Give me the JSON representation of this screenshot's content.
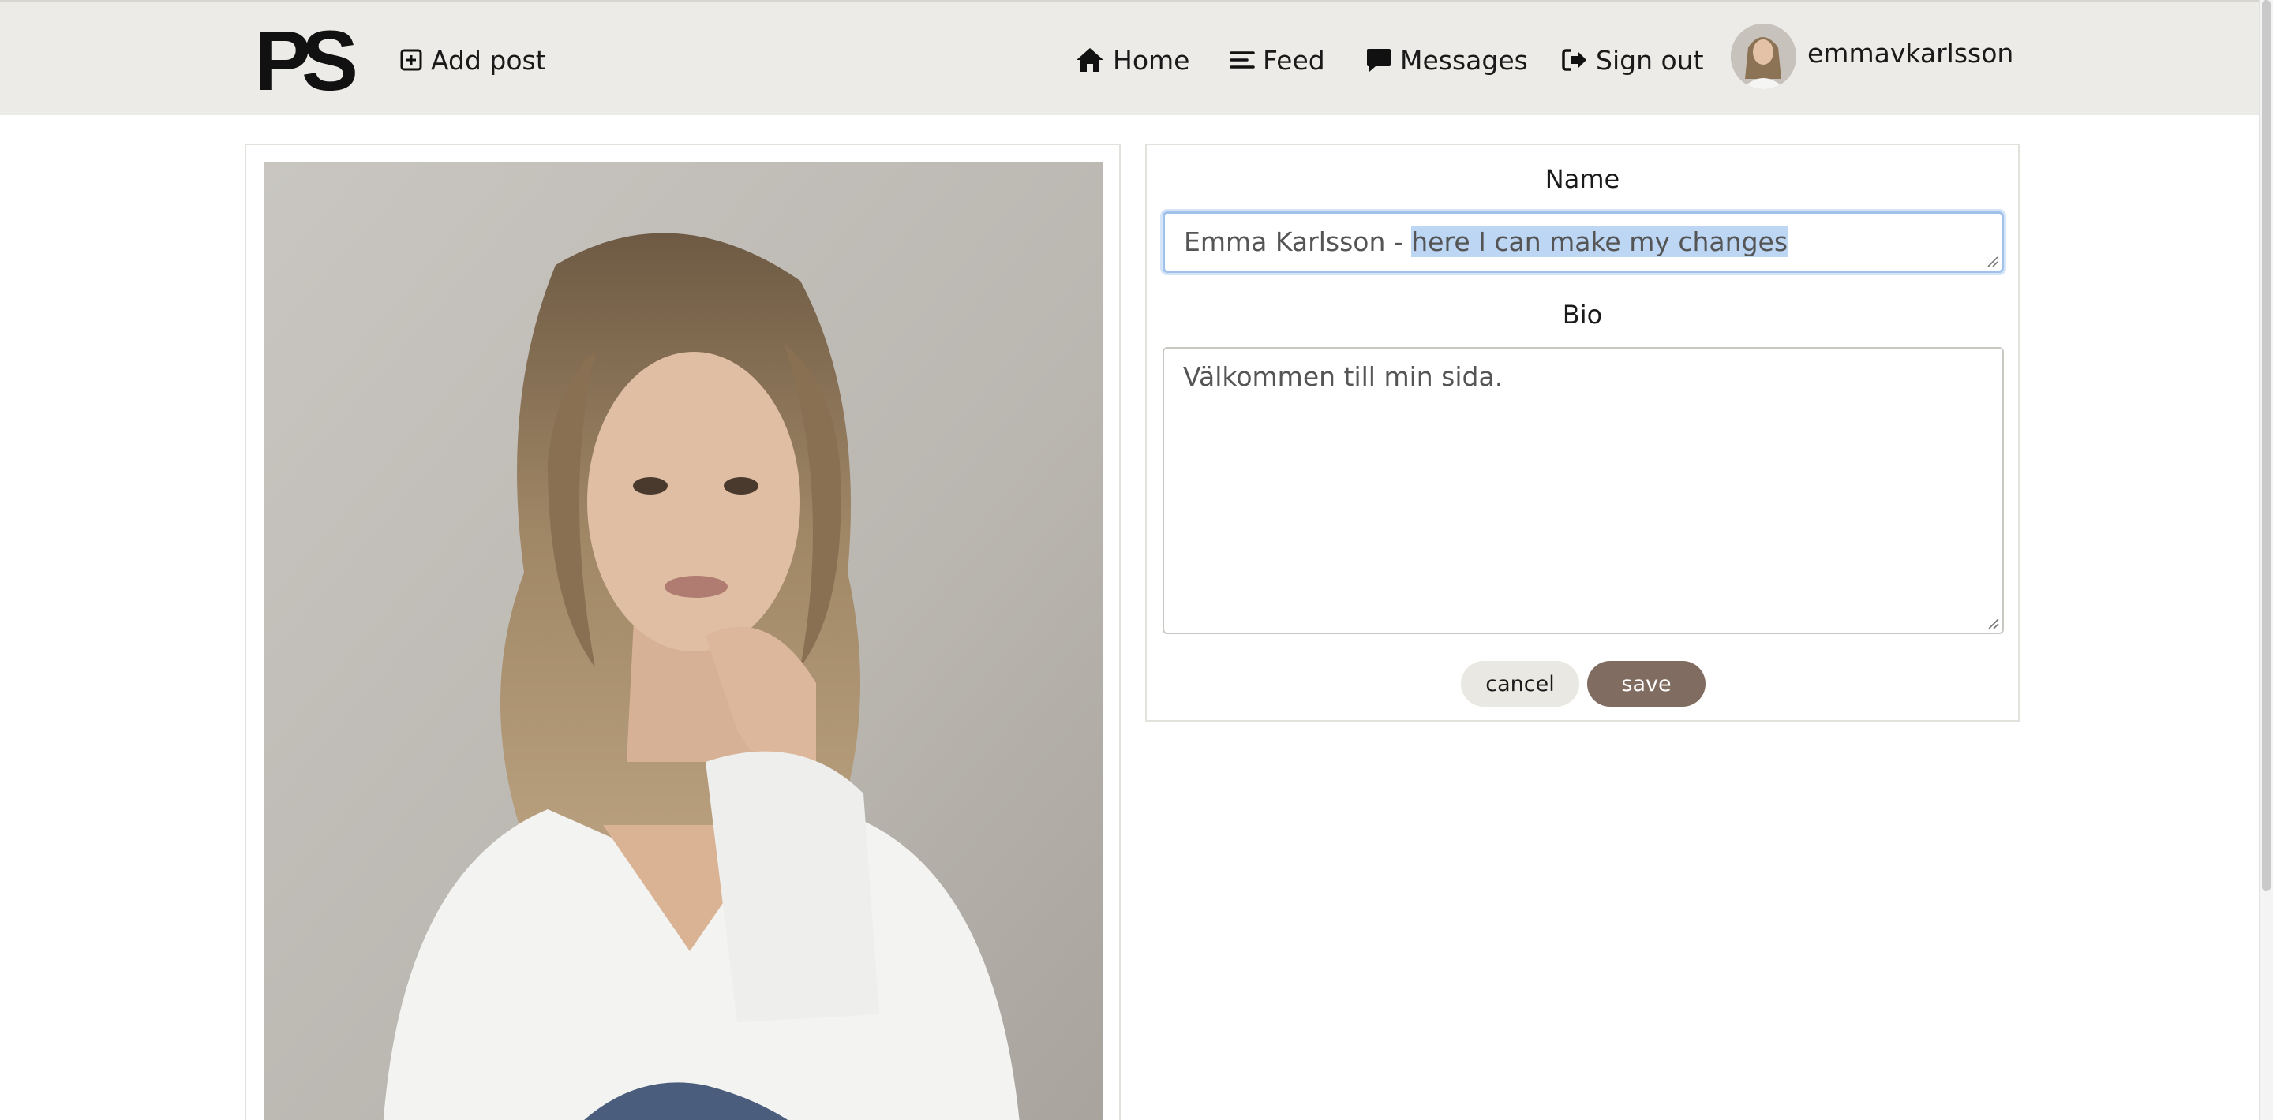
{
  "header": {
    "logo_text": "PS",
    "nav": {
      "add_post": "Add post",
      "home": "Home",
      "feed": "Feed",
      "messages": "Messages",
      "sign_out": "Sign out"
    },
    "username": "emmavkarlsson"
  },
  "edit_profile": {
    "name_label": "Name",
    "name_value_prefix": "Emma Karlsson - ",
    "name_value_selected": "here I can make my changes",
    "bio_label": "Bio",
    "bio_value": "Välkommen till min sida.",
    "cancel_label": "cancel",
    "save_label": "save"
  },
  "colors": {
    "header_bg": "#ecebe7",
    "save_button": "#806c60",
    "cancel_button": "#e9e8e3",
    "focus_ring": "#9fc1ea",
    "selection": "#bcd6f4"
  }
}
